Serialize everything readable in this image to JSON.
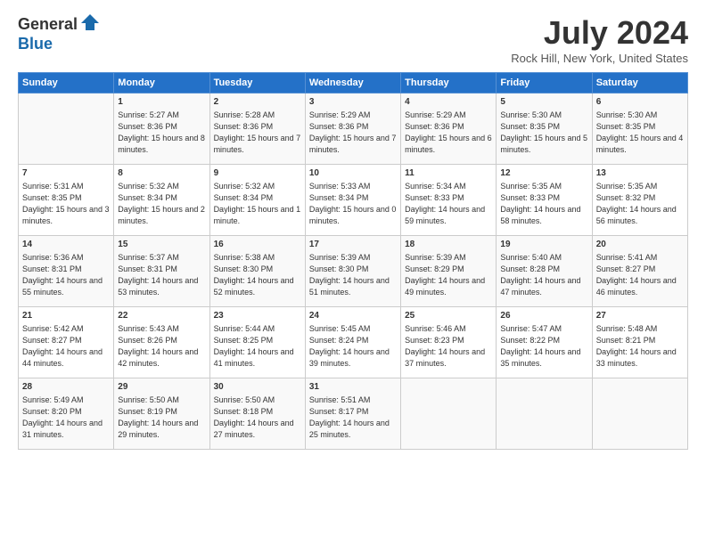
{
  "header": {
    "logo_general": "General",
    "logo_blue": "Blue",
    "title": "July 2024",
    "subtitle": "Rock Hill, New York, United States"
  },
  "days_of_week": [
    "Sunday",
    "Monday",
    "Tuesday",
    "Wednesday",
    "Thursday",
    "Friday",
    "Saturday"
  ],
  "weeks": [
    [
      {
        "date": "",
        "sunrise": "",
        "sunset": "",
        "daylight": ""
      },
      {
        "date": "1",
        "sunrise": "Sunrise: 5:27 AM",
        "sunset": "Sunset: 8:36 PM",
        "daylight": "Daylight: 15 hours and 8 minutes."
      },
      {
        "date": "2",
        "sunrise": "Sunrise: 5:28 AM",
        "sunset": "Sunset: 8:36 PM",
        "daylight": "Daylight: 15 hours and 7 minutes."
      },
      {
        "date": "3",
        "sunrise": "Sunrise: 5:29 AM",
        "sunset": "Sunset: 8:36 PM",
        "daylight": "Daylight: 15 hours and 7 minutes."
      },
      {
        "date": "4",
        "sunrise": "Sunrise: 5:29 AM",
        "sunset": "Sunset: 8:36 PM",
        "daylight": "Daylight: 15 hours and 6 minutes."
      },
      {
        "date": "5",
        "sunrise": "Sunrise: 5:30 AM",
        "sunset": "Sunset: 8:35 PM",
        "daylight": "Daylight: 15 hours and 5 minutes."
      },
      {
        "date": "6",
        "sunrise": "Sunrise: 5:30 AM",
        "sunset": "Sunset: 8:35 PM",
        "daylight": "Daylight: 15 hours and 4 minutes."
      }
    ],
    [
      {
        "date": "7",
        "sunrise": "Sunrise: 5:31 AM",
        "sunset": "Sunset: 8:35 PM",
        "daylight": "Daylight: 15 hours and 3 minutes."
      },
      {
        "date": "8",
        "sunrise": "Sunrise: 5:32 AM",
        "sunset": "Sunset: 8:34 PM",
        "daylight": "Daylight: 15 hours and 2 minutes."
      },
      {
        "date": "9",
        "sunrise": "Sunrise: 5:32 AM",
        "sunset": "Sunset: 8:34 PM",
        "daylight": "Daylight: 15 hours and 1 minute."
      },
      {
        "date": "10",
        "sunrise": "Sunrise: 5:33 AM",
        "sunset": "Sunset: 8:34 PM",
        "daylight": "Daylight: 15 hours and 0 minutes."
      },
      {
        "date": "11",
        "sunrise": "Sunrise: 5:34 AM",
        "sunset": "Sunset: 8:33 PM",
        "daylight": "Daylight: 14 hours and 59 minutes."
      },
      {
        "date": "12",
        "sunrise": "Sunrise: 5:35 AM",
        "sunset": "Sunset: 8:33 PM",
        "daylight": "Daylight: 14 hours and 58 minutes."
      },
      {
        "date": "13",
        "sunrise": "Sunrise: 5:35 AM",
        "sunset": "Sunset: 8:32 PM",
        "daylight": "Daylight: 14 hours and 56 minutes."
      }
    ],
    [
      {
        "date": "14",
        "sunrise": "Sunrise: 5:36 AM",
        "sunset": "Sunset: 8:31 PM",
        "daylight": "Daylight: 14 hours and 55 minutes."
      },
      {
        "date": "15",
        "sunrise": "Sunrise: 5:37 AM",
        "sunset": "Sunset: 8:31 PM",
        "daylight": "Daylight: 14 hours and 53 minutes."
      },
      {
        "date": "16",
        "sunrise": "Sunrise: 5:38 AM",
        "sunset": "Sunset: 8:30 PM",
        "daylight": "Daylight: 14 hours and 52 minutes."
      },
      {
        "date": "17",
        "sunrise": "Sunrise: 5:39 AM",
        "sunset": "Sunset: 8:30 PM",
        "daylight": "Daylight: 14 hours and 51 minutes."
      },
      {
        "date": "18",
        "sunrise": "Sunrise: 5:39 AM",
        "sunset": "Sunset: 8:29 PM",
        "daylight": "Daylight: 14 hours and 49 minutes."
      },
      {
        "date": "19",
        "sunrise": "Sunrise: 5:40 AM",
        "sunset": "Sunset: 8:28 PM",
        "daylight": "Daylight: 14 hours and 47 minutes."
      },
      {
        "date": "20",
        "sunrise": "Sunrise: 5:41 AM",
        "sunset": "Sunset: 8:27 PM",
        "daylight": "Daylight: 14 hours and 46 minutes."
      }
    ],
    [
      {
        "date": "21",
        "sunrise": "Sunrise: 5:42 AM",
        "sunset": "Sunset: 8:27 PM",
        "daylight": "Daylight: 14 hours and 44 minutes."
      },
      {
        "date": "22",
        "sunrise": "Sunrise: 5:43 AM",
        "sunset": "Sunset: 8:26 PM",
        "daylight": "Daylight: 14 hours and 42 minutes."
      },
      {
        "date": "23",
        "sunrise": "Sunrise: 5:44 AM",
        "sunset": "Sunset: 8:25 PM",
        "daylight": "Daylight: 14 hours and 41 minutes."
      },
      {
        "date": "24",
        "sunrise": "Sunrise: 5:45 AM",
        "sunset": "Sunset: 8:24 PM",
        "daylight": "Daylight: 14 hours and 39 minutes."
      },
      {
        "date": "25",
        "sunrise": "Sunrise: 5:46 AM",
        "sunset": "Sunset: 8:23 PM",
        "daylight": "Daylight: 14 hours and 37 minutes."
      },
      {
        "date": "26",
        "sunrise": "Sunrise: 5:47 AM",
        "sunset": "Sunset: 8:22 PM",
        "daylight": "Daylight: 14 hours and 35 minutes."
      },
      {
        "date": "27",
        "sunrise": "Sunrise: 5:48 AM",
        "sunset": "Sunset: 8:21 PM",
        "daylight": "Daylight: 14 hours and 33 minutes."
      }
    ],
    [
      {
        "date": "28",
        "sunrise": "Sunrise: 5:49 AM",
        "sunset": "Sunset: 8:20 PM",
        "daylight": "Daylight: 14 hours and 31 minutes."
      },
      {
        "date": "29",
        "sunrise": "Sunrise: 5:50 AM",
        "sunset": "Sunset: 8:19 PM",
        "daylight": "Daylight: 14 hours and 29 minutes."
      },
      {
        "date": "30",
        "sunrise": "Sunrise: 5:50 AM",
        "sunset": "Sunset: 8:18 PM",
        "daylight": "Daylight: 14 hours and 27 minutes."
      },
      {
        "date": "31",
        "sunrise": "Sunrise: 5:51 AM",
        "sunset": "Sunset: 8:17 PM",
        "daylight": "Daylight: 14 hours and 25 minutes."
      },
      {
        "date": "",
        "sunrise": "",
        "sunset": "",
        "daylight": ""
      },
      {
        "date": "",
        "sunrise": "",
        "sunset": "",
        "daylight": ""
      },
      {
        "date": "",
        "sunrise": "",
        "sunset": "",
        "daylight": ""
      }
    ]
  ]
}
